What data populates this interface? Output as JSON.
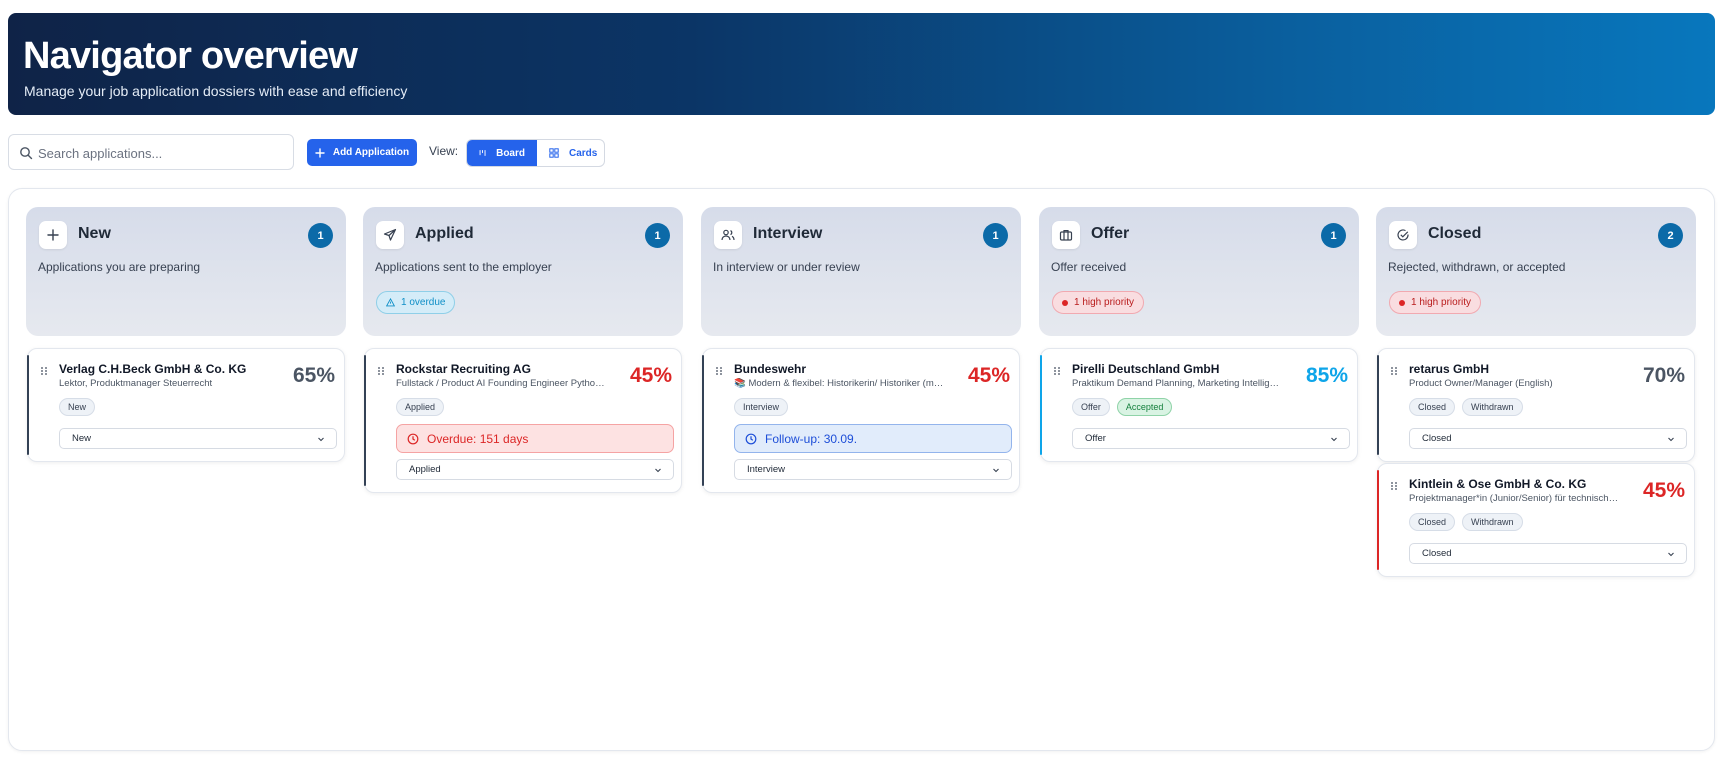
{
  "header": {
    "title": "Navigator overview",
    "subtitle": "Manage your job application dossiers with ease and efficiency"
  },
  "toolbar": {
    "search_placeholder": "Search applications...",
    "add_label": "Add Application",
    "view_label": "View:",
    "board_label": "Board",
    "cards_label": "Cards",
    "active_view": "Board"
  },
  "colors": {
    "primary": "#2563eb",
    "count_badge": "#0b6aa8",
    "pct_gray": "#4b5563",
    "pct_red": "#dc2626",
    "pct_cyan": "#0ea5e9"
  },
  "columns": [
    {
      "title": "New",
      "count": "1",
      "desc": "Applications you are preparing",
      "icon": "plus-icon",
      "cards": [
        {
          "company": "Verlag C.H.Beck GmbH & Co. KG",
          "role": "Lektor, Produktmanager Steuerrecht",
          "pct": "65%",
          "tags": [
            "New"
          ],
          "status": "New"
        }
      ]
    },
    {
      "title": "Applied",
      "count": "1",
      "desc": "Applications sent to the employer",
      "icon": "send-icon",
      "badge": "1 overdue",
      "cards": [
        {
          "company": "Rockstar Recruiting AG",
          "role": "Fullstack / Product AI Founding Engineer Python 🚀",
          "pct": "45%",
          "tags": [
            "Applied"
          ],
          "alert": "Overdue: 151 days",
          "status": "Applied"
        }
      ]
    },
    {
      "title": "Interview",
      "count": "1",
      "desc": "In interview or under review",
      "icon": "users-icon",
      "cards": [
        {
          "company": "Bundeswehr",
          "role": "📚 Modern & flexibel: Historikerin/ Historiker (m/w/d)",
          "pct": "45%",
          "tags": [
            "Interview"
          ],
          "alert": "Follow-up: 30.09.",
          "status": "Interview"
        }
      ]
    },
    {
      "title": "Offer",
      "count": "1",
      "desc": "Offer received",
      "icon": "briefcase-icon",
      "badge": "1 high priority",
      "cards": [
        {
          "company": "Pirelli Deutschland GmbH",
          "role": "Praktikum Demand Planning, Marketing Intelligence",
          "pct": "85%",
          "tags": [
            "Offer",
            "Accepted"
          ],
          "status": "Offer"
        }
      ]
    },
    {
      "title": "Closed",
      "count": "2",
      "desc": "Rejected, withdrawn, or accepted",
      "icon": "check-circle-icon",
      "badge": "1 high priority",
      "cards": [
        {
          "company": "retarus GmbH",
          "role": "Product Owner/Manager (English)",
          "pct": "70%",
          "tags": [
            "Closed",
            "Withdrawn"
          ],
          "status": "Closed"
        },
        {
          "company": "Kintlein & Ose GmbH & Co. KG",
          "role": "Projektmanager*in (Junior/Senior) für technische Projekte",
          "pct": "45%",
          "tags": [
            "Closed",
            "Withdrawn"
          ],
          "status": "Closed"
        }
      ]
    }
  ]
}
